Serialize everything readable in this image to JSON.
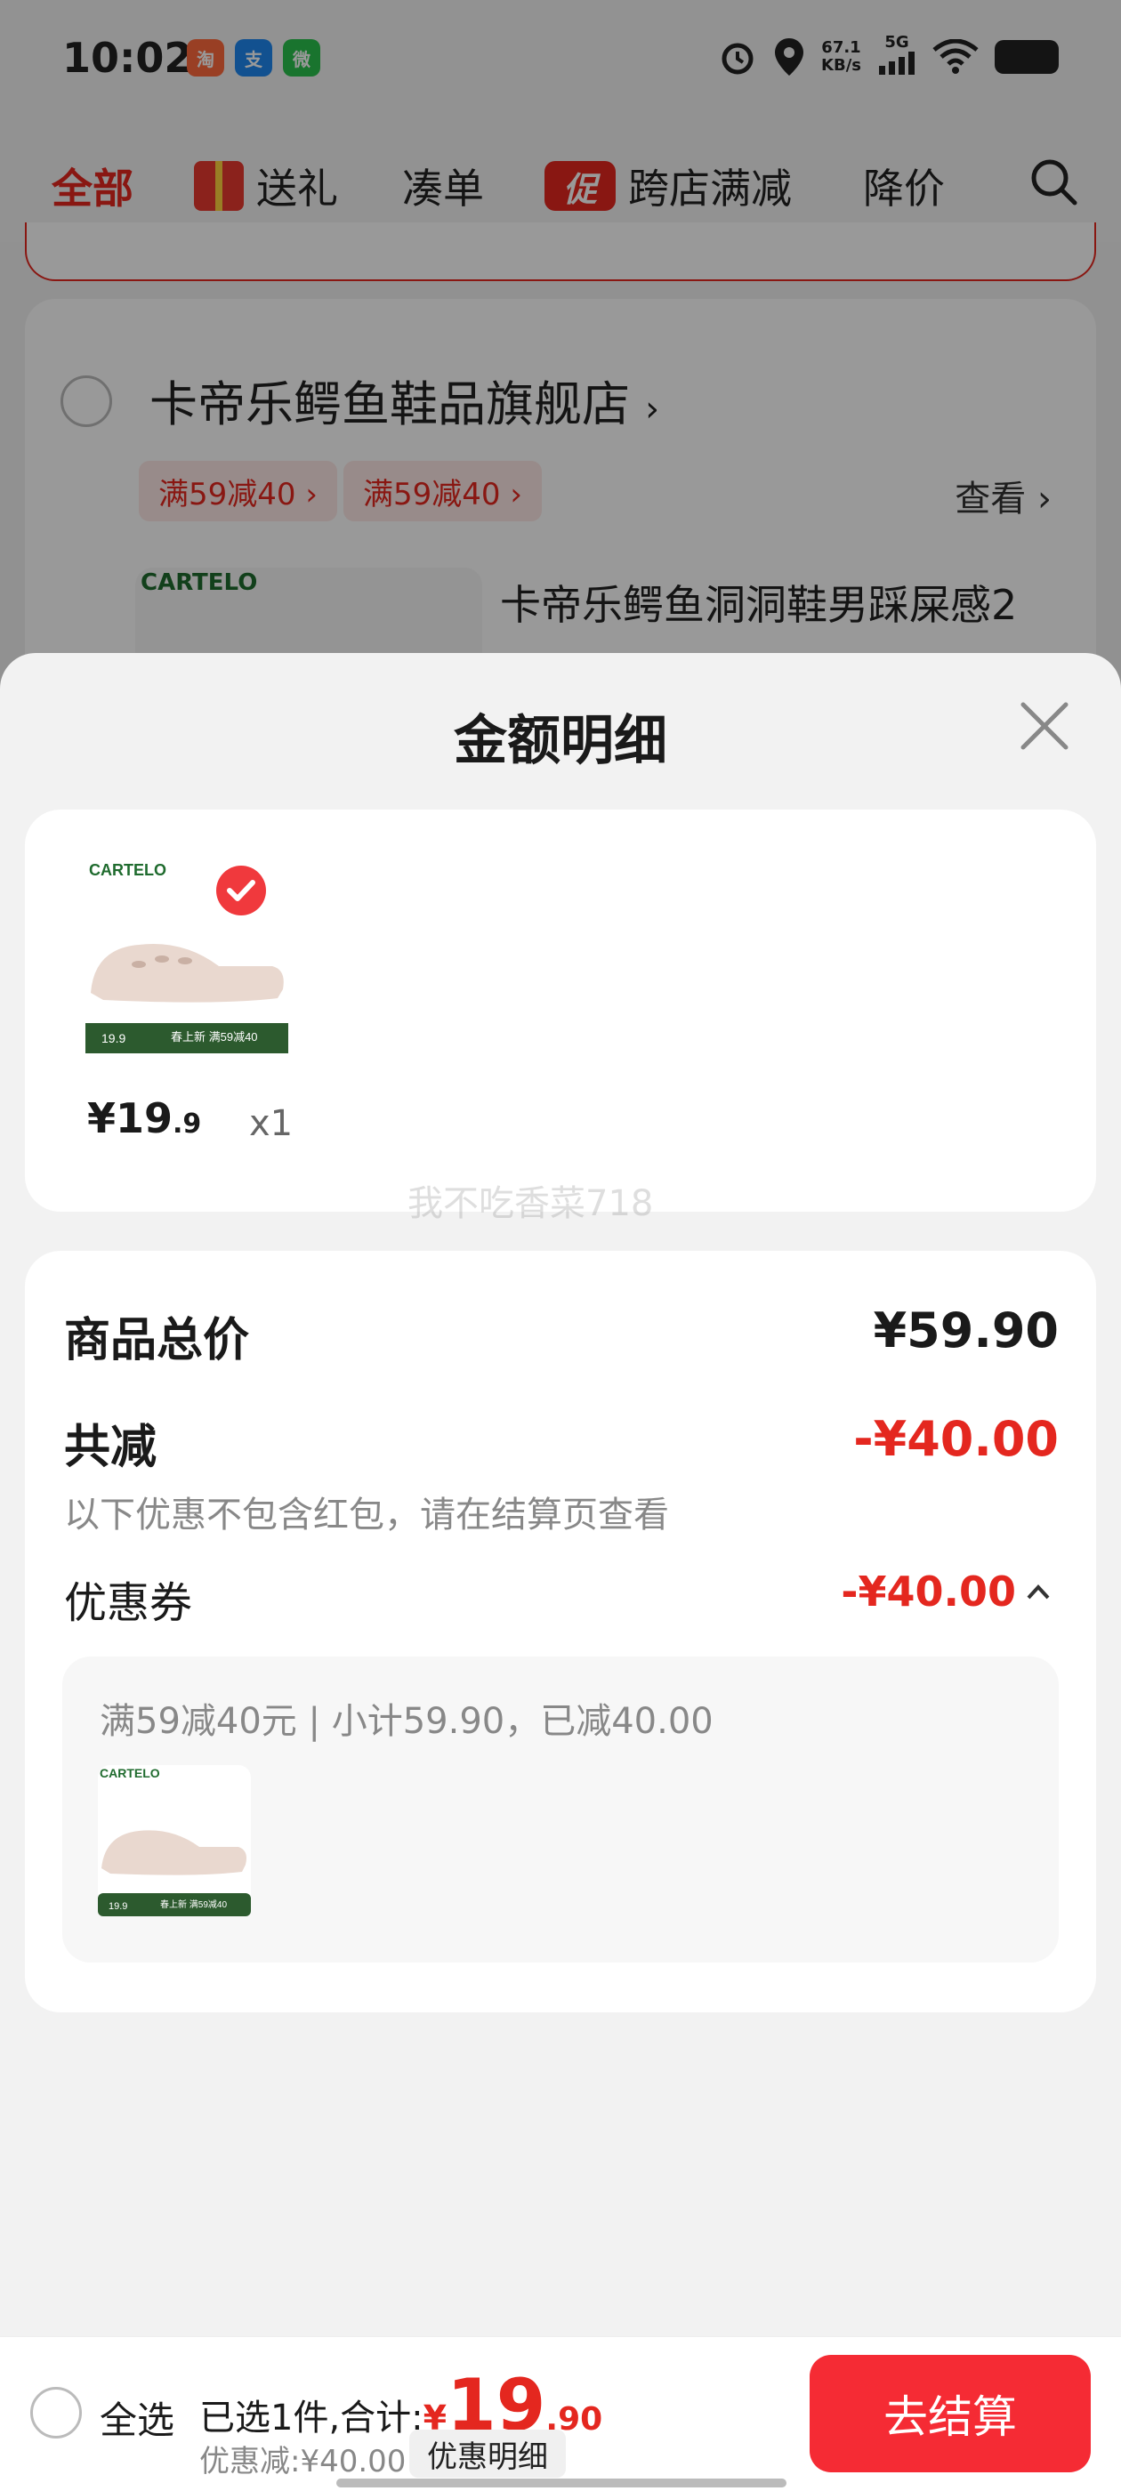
{
  "status_bar": {
    "time": "10:02",
    "apps": [
      "taobao-app-icon",
      "alipay-app-icon",
      "wechat-app-icon"
    ],
    "net_speed": "67.1",
    "net_unit": "KB/s",
    "signal": "5G"
  },
  "top_tabs": [
    {
      "label": "全部",
      "active": true
    },
    {
      "label": "送礼",
      "icon": "gift-icon"
    },
    {
      "label": "凑单"
    },
    {
      "label": "跨店满减",
      "icon_text": "促"
    },
    {
      "label": "降价"
    }
  ],
  "background": {
    "store_name": "卡帝乐鳄鱼鞋品旗舰店",
    "store_arrow": "›",
    "chips": [
      "满59减40 ›",
      "满59减40 ›"
    ],
    "view_label": "查看 ›",
    "product_title": "卡帝乐鳄鱼洞洞鞋男踩屎感2",
    "brand_logo": "CARTELO"
  },
  "sheet": {
    "title": "金额明细",
    "item": {
      "price_symbol": "¥",
      "price_int": "19",
      "price_dec": ".9",
      "qty": "x1",
      "brand_logo": "CARTELO",
      "banner_text": "春上新 满59减40",
      "banner_price": "19.9"
    },
    "watermark": "我不吃香菜718",
    "total_label": "商品总价",
    "total_value": "¥59.90",
    "discount_label": "共减",
    "discount_value": "-¥40.00",
    "discount_note": "以下优惠不包含红包，请在结算页查看",
    "coupon_label": "优惠券",
    "coupon_value": "-¥40.00",
    "coupon_desc": "满59减40元 | 小计59.90，已减40.00"
  },
  "bottom_bar": {
    "select_all": "全选",
    "selected_text": "已选1件,合计:",
    "currency": "¥",
    "total_int": "19",
    "total_dec": ".90",
    "discount_text": "优惠减:¥40.00",
    "detail_button": "优惠明细",
    "checkout_button": "去结算"
  },
  "colors": {
    "accent_red": "#e4271f",
    "checkout_red": "#f52b34"
  }
}
